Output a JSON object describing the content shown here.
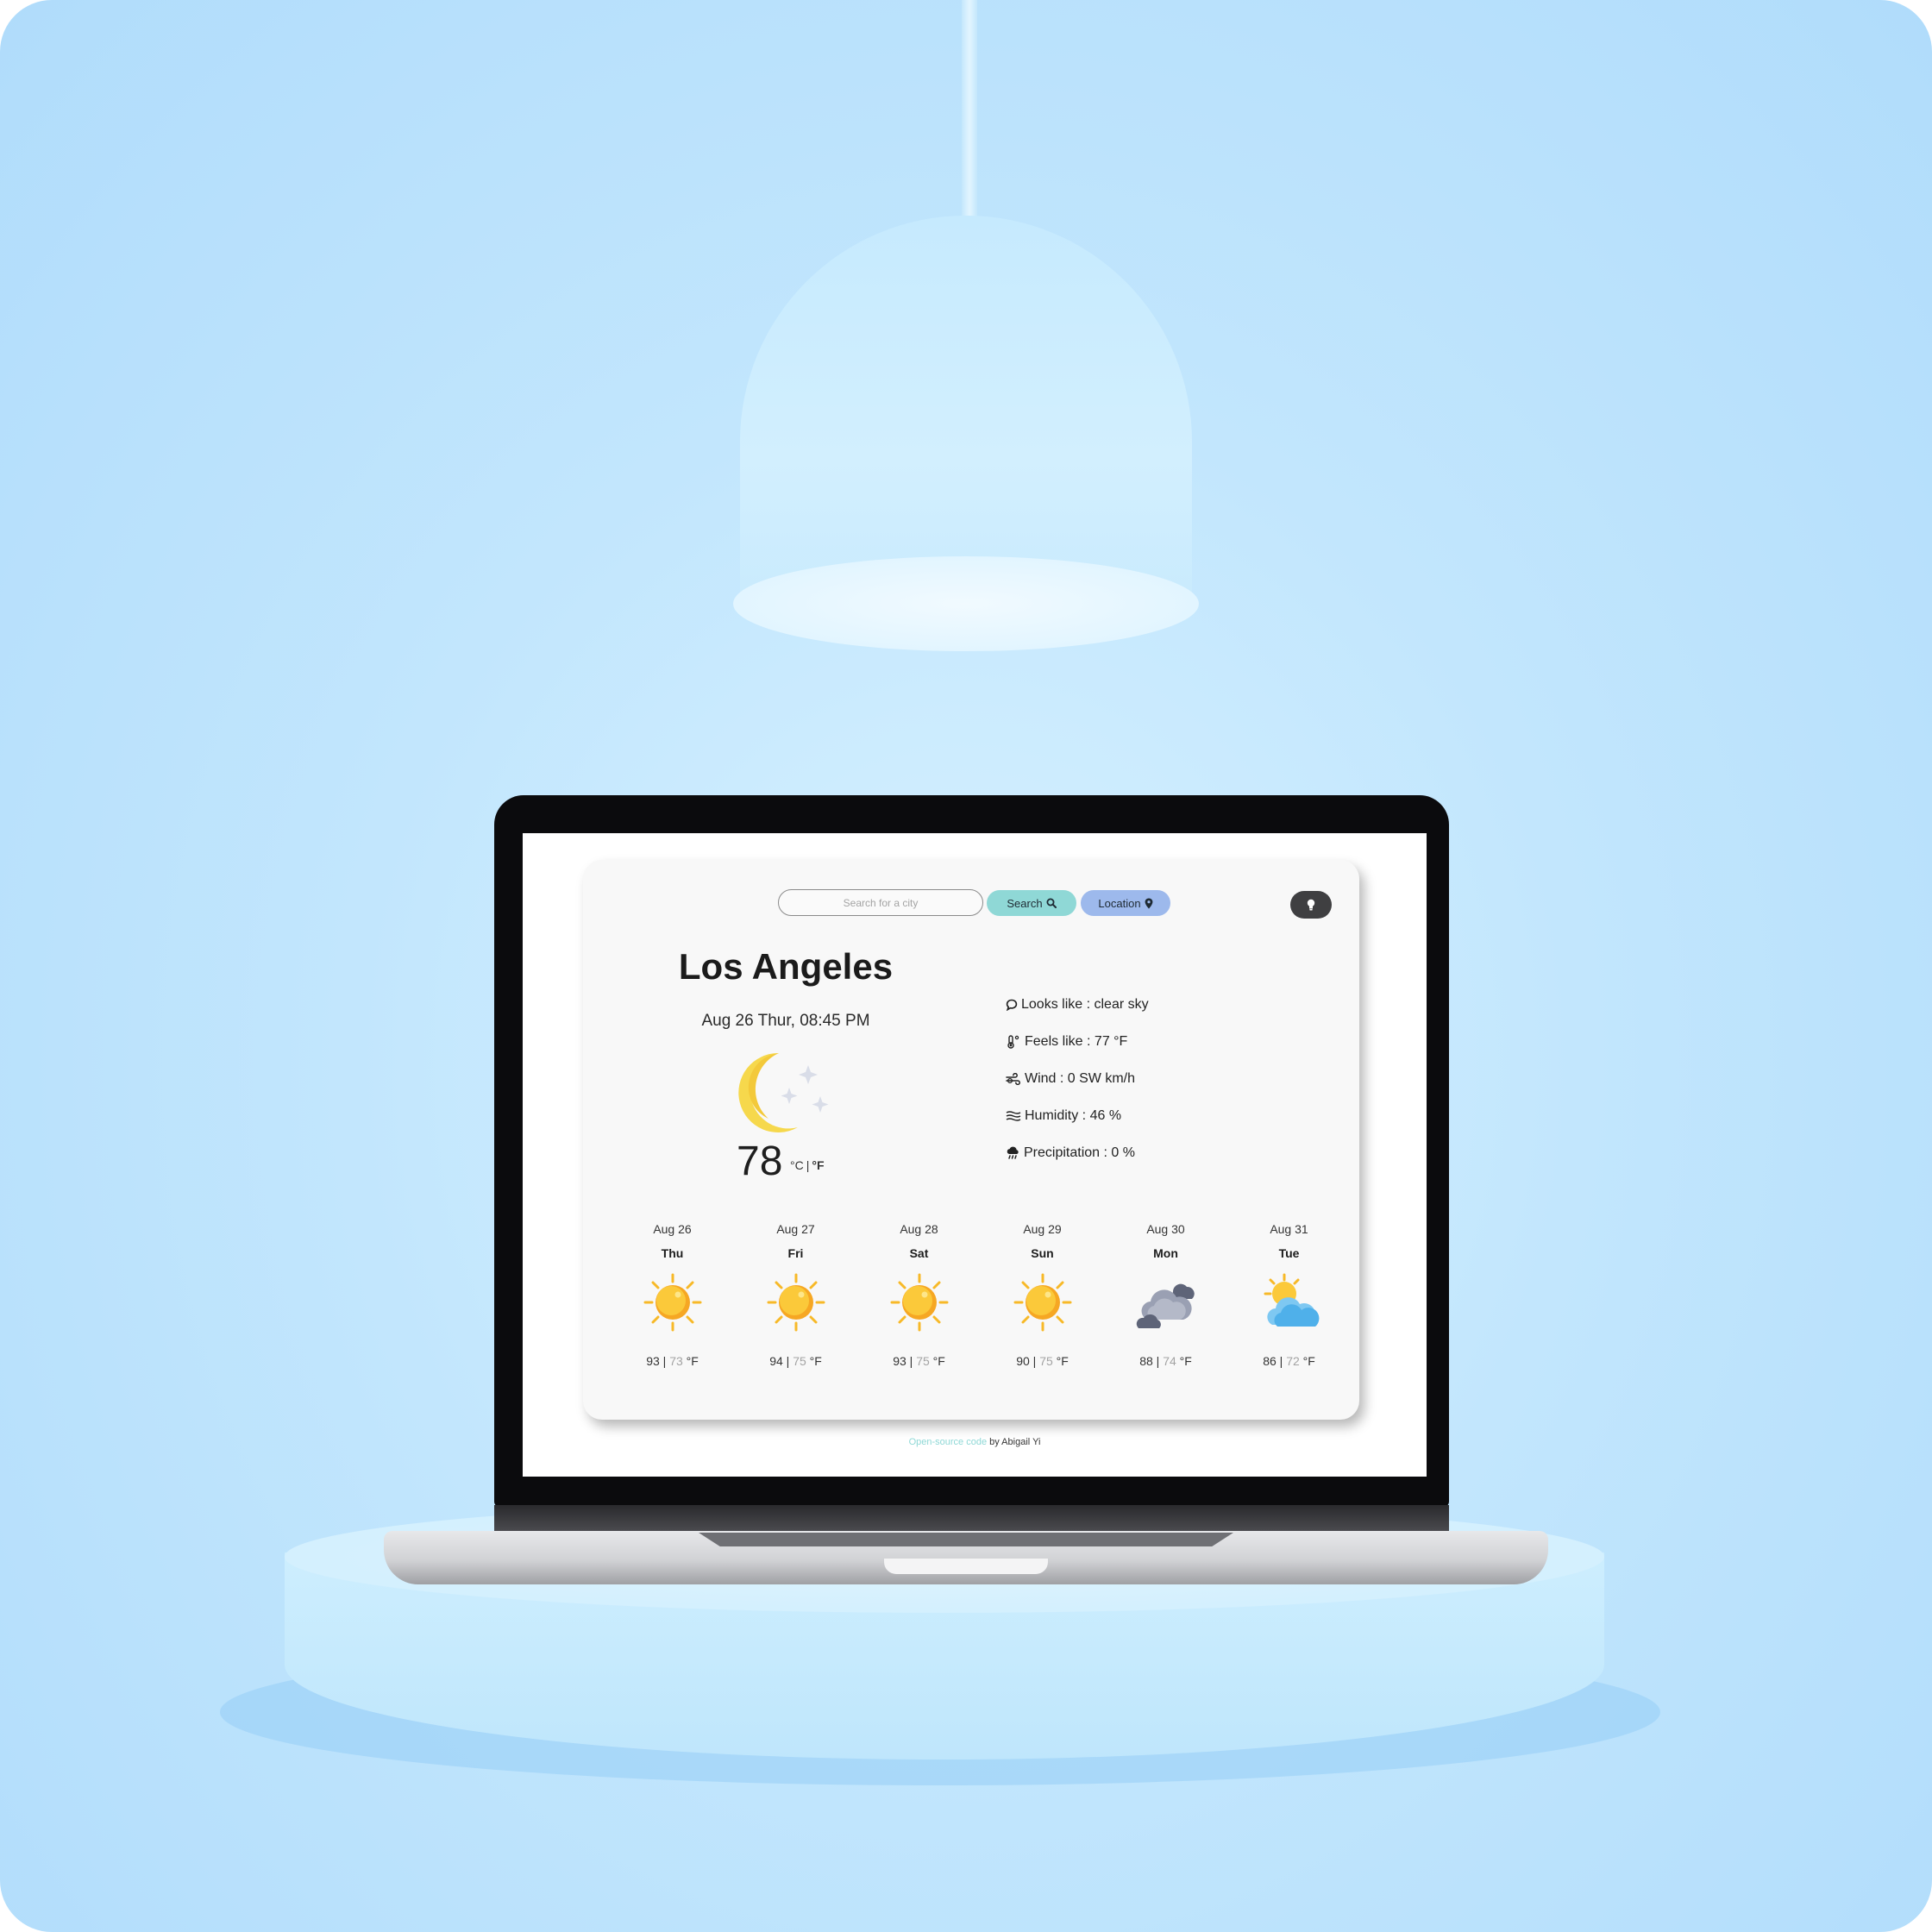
{
  "search": {
    "placeholder": "Search for a city",
    "button_label": "Search"
  },
  "location": {
    "button_label": "Location"
  },
  "current": {
    "city": "Los Angeles",
    "datetime": "Aug 26 Thur, 08:45 PM",
    "icon": "moon-stars-icon",
    "temperature": "78",
    "unit_c": "°C",
    "unit_sep": "|",
    "unit_f": "°F"
  },
  "details": [
    {
      "icon": "speech-bubble-icon",
      "text": "Looks like : clear sky"
    },
    {
      "icon": "thermometer-icon",
      "text": "Feels like : 77 °F"
    },
    {
      "icon": "wind-icon",
      "text": "Wind : 0 SW km/h"
    },
    {
      "icon": "humidity-icon",
      "text": "Humidity : 46 %"
    },
    {
      "icon": "rain-cloud-icon",
      "text": "Precipitation : 0 %"
    }
  ],
  "forecast": [
    {
      "date": "Aug 26",
      "day": "Thu",
      "icon": "sun-icon",
      "high": "93",
      "low": "73",
      "unit": "°F"
    },
    {
      "date": "Aug 27",
      "day": "Fri",
      "icon": "sun-icon",
      "high": "94",
      "low": "75",
      "unit": "°F"
    },
    {
      "date": "Aug 28",
      "day": "Sat",
      "icon": "sun-icon",
      "high": "93",
      "low": "75",
      "unit": "°F"
    },
    {
      "date": "Aug 29",
      "day": "Sun",
      "icon": "sun-icon",
      "high": "90",
      "low": "75",
      "unit": "°F"
    },
    {
      "date": "Aug 30",
      "day": "Mon",
      "icon": "dark-clouds-icon",
      "high": "88",
      "low": "74",
      "unit": "°F"
    },
    {
      "date": "Aug 31",
      "day": "Tue",
      "icon": "partly-cloudy-icon",
      "high": "86",
      "low": "72",
      "unit": "°F"
    }
  ],
  "footer": {
    "link_text": "Open-source code",
    "suffix": " by Abigail Yi"
  },
  "colors": {
    "search_button": "#8fd8d6",
    "location_button": "#9db9ec",
    "theme_button": "#3f3f41"
  }
}
